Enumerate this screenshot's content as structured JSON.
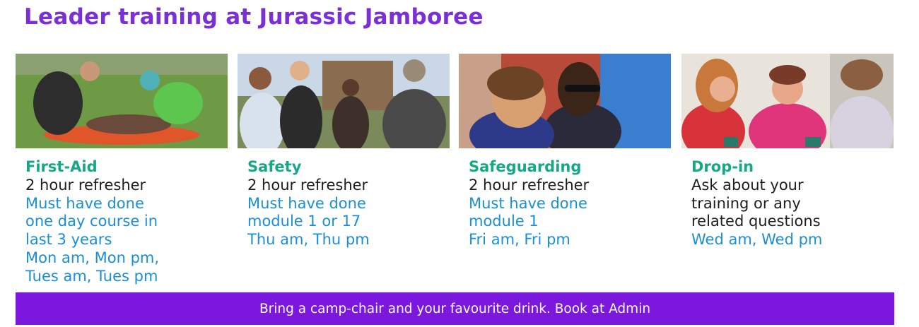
{
  "title": "Leader training at Jurassic Jamboree",
  "cards": [
    {
      "heading": "First-Aid",
      "duration": "2 hour refresher",
      "prerequisite": [
        "Must have done",
        "one day course in",
        "last 3 years"
      ],
      "times": [
        "Mon am, Mon pm,",
        "Tues am, Tues pm"
      ]
    },
    {
      "heading": "Safety",
      "duration": "2 hour refresher",
      "prerequisite": [
        "Must have done",
        "module 1 or 17"
      ],
      "times": [
        "Thu am, Thu pm"
      ]
    },
    {
      "heading": "Safeguarding",
      "duration": "2 hour refresher",
      "prerequisite": [
        "Must have done",
        "module 1"
      ],
      "times": [
        "Fri am, Fri pm"
      ]
    },
    {
      "heading": "Drop-in",
      "duration": [
        "Ask about your",
        "training or any",
        "related questions"
      ],
      "times": [
        "Wed am,  Wed pm"
      ]
    }
  ],
  "banner": "Bring a camp-chair and your favourite drink. Book at Admin",
  "colors": {
    "title": "#7b2fd6",
    "heading": "#16a886",
    "body_text": "#1e1e1e",
    "detail_text": "#1a8ed6",
    "banner_bg": "#7c18dd"
  }
}
